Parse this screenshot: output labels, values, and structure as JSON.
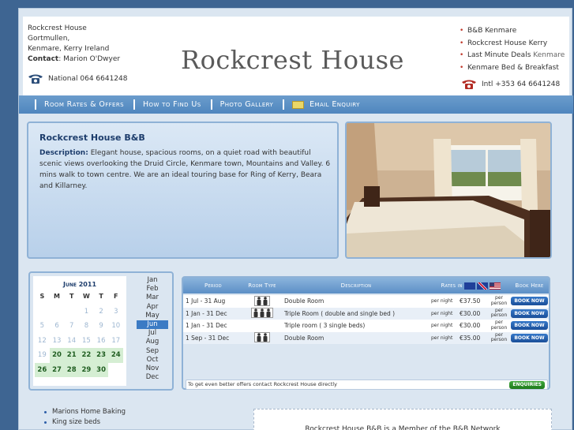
{
  "header": {
    "address_lines": [
      "Rockcrest House",
      "Gortmullen,",
      "Kenmare, Kerry Ireland"
    ],
    "contact_label": "Contact",
    "contact_name": "Marion O'Dwyer",
    "phone_national": "National 064 6641248",
    "logo_text": "Rockcrest House",
    "links": [
      {
        "text": "B&B Kenmare",
        "suffix": ""
      },
      {
        "text": "Rockcrest House Kerry",
        "suffix": ""
      },
      {
        "text": "Last Minute Deals",
        "suffix": "Kenmare"
      },
      {
        "text": "Kenmare Bed & Breakfast",
        "suffix": ""
      }
    ],
    "phone_intl": "Intl +353 64 6641248"
  },
  "nav": {
    "items": [
      "Room Rates & Offers",
      "How to Find Us",
      "Photo Gallery",
      "Email Enquiry"
    ]
  },
  "description": {
    "title": "Rockcrest House B&B",
    "label": "Description:",
    "text": "Elegant house, spacious rooms, on a quiet road with beautiful scenic views overlooking the Druid Circle, Kenmare town, Mountains and Valley. 6 mins walk to town centre. We are an ideal touring base for Ring of Kerry, Beara and Killarney."
  },
  "calendar": {
    "title": "June 2011",
    "weekdays": [
      "S",
      "M",
      "T",
      "W",
      "T",
      "F",
      "S"
    ],
    "weeks": [
      [
        "",
        "",
        "",
        "1",
        "2",
        "3",
        "4"
      ],
      [
        "5",
        "6",
        "7",
        "8",
        "9",
        "10",
        "11"
      ],
      [
        "12",
        "13",
        "14",
        "15",
        "16",
        "17",
        "18"
      ],
      [
        "19",
        "20",
        "21",
        "22",
        "23",
        "24",
        "25"
      ],
      [
        "26",
        "27",
        "28",
        "29",
        "30",
        "",
        ""
      ]
    ],
    "available_from": 20,
    "months": [
      "Jan",
      "Feb",
      "Mar",
      "Apr",
      "May",
      "Jun",
      "Jul",
      "Aug",
      "Sep",
      "Oct",
      "Nov",
      "Dec"
    ],
    "selected_month": "Jun"
  },
  "rates": {
    "headers": [
      "Period",
      "Room Type",
      "Description",
      "Rates in",
      "Book Here"
    ],
    "rows": [
      {
        "period": "1 Jul - 31 Aug",
        "people": 2,
        "description": "Double Room",
        "basis": "per night",
        "price": "€37.50",
        "unit": "per person",
        "book": "BOOK NOW"
      },
      {
        "period": "1 Jan - 31 Dec",
        "people": 3,
        "description": "Triple Room ( double and single bed )",
        "basis": "per night",
        "price": "€30.00",
        "unit": "per person",
        "book": "BOOK NOW"
      },
      {
        "period": "1 Jan - 31 Dec",
        "people": 0,
        "description": "Triple room ( 3 single beds)",
        "basis": "per night",
        "price": "€30.00",
        "unit": "per person",
        "book": "BOOK NOW"
      },
      {
        "period": "1 Sep - 31 Dec",
        "people": 2,
        "description": "Double Room",
        "basis": "per night",
        "price": "€35.00",
        "unit": "per person",
        "book": "BOOK NOW"
      }
    ],
    "footer_text": "To get even better offers contact Rockcrest House directly",
    "enquiries_label": "ENQUIRIES"
  },
  "features": [
    "Marions Home Baking",
    "King size beds"
  ],
  "network_text": "Rockcrest House B&B is a Member of the B&B Network",
  "colors": {
    "background": "#3e6592",
    "nav": "#5c8fc6",
    "accent_red": "#c0392b",
    "title_blue": "#1d3d6c"
  }
}
